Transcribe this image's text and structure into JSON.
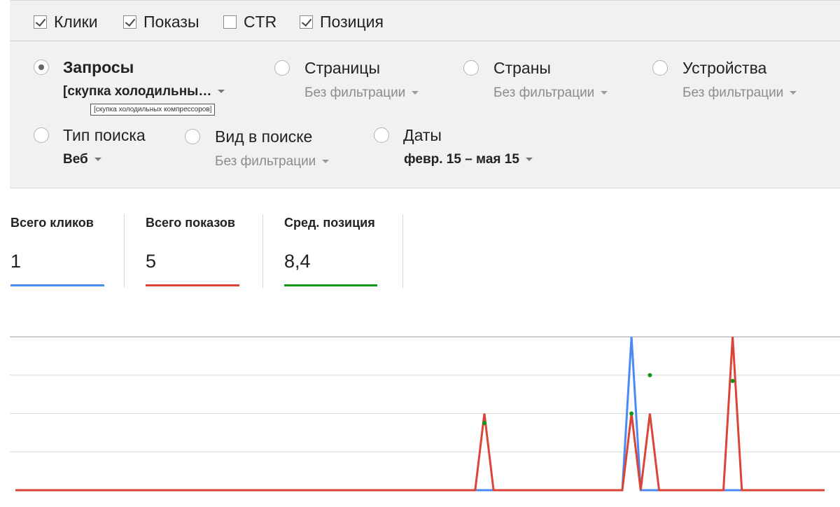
{
  "metrics": [
    {
      "label": "Клики",
      "checked": true
    },
    {
      "label": "Показы",
      "checked": true
    },
    {
      "label": "CTR",
      "checked": false
    },
    {
      "label": "Позиция",
      "checked": true
    }
  ],
  "dimensions": {
    "queries": {
      "label": "Запросы",
      "filter": "[скупка холодильны…",
      "selected": true,
      "tooltip": "[скупка холодильных компрессоров]"
    },
    "pages": {
      "label": "Страницы",
      "filter": "Без фильтрации",
      "selected": false
    },
    "countries": {
      "label": "Страны",
      "filter": "Без фильтрации",
      "selected": false
    },
    "devices": {
      "label": "Устройства",
      "filter": "Без фильтрации",
      "selected": false
    },
    "search_type": {
      "label": "Тип поиска",
      "filter": "Веб",
      "selected": false
    },
    "appearance": {
      "label": "Вид в поиске",
      "filter": "Без фильтрации",
      "selected": false
    },
    "dates": {
      "label": "Даты",
      "filter": "февр. 15 – мая 15",
      "selected": false
    }
  },
  "totals": {
    "clicks": {
      "label": "Всего кликов",
      "value": "1",
      "color": "#4a8af4"
    },
    "impressions": {
      "label": "Всего показов",
      "value": "5",
      "color": "#db4437"
    },
    "position": {
      "label": "Сред. позиция",
      "value": "8,4",
      "color": "#109618"
    }
  },
  "chart_data": {
    "type": "line",
    "x_count": 89,
    "gridlines": true,
    "series": [
      {
        "name": "Всего кликов",
        "color": "#4a8af4",
        "points": [
          [
            67,
            1
          ]
        ]
      },
      {
        "name": "Всего показов",
        "color": "#db4437",
        "points": [
          [
            51,
            2
          ],
          [
            67,
            2
          ],
          [
            69,
            2
          ],
          [
            78,
            4
          ]
        ]
      },
      {
        "name": "Сред. позиция",
        "color": "#109618",
        "points": [
          [
            51,
            10
          ],
          [
            67,
            9
          ],
          [
            69,
            5
          ],
          [
            78,
            5.6
          ]
        ]
      }
    ]
  }
}
